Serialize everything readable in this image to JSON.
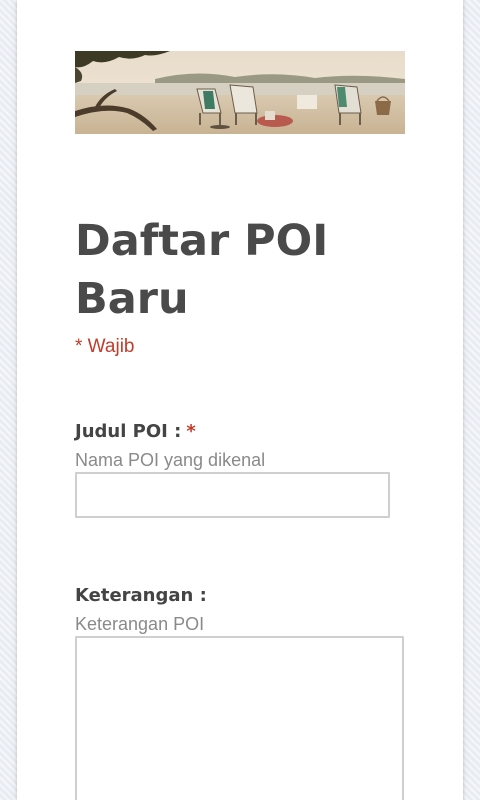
{
  "form": {
    "banner_image": "beach-chairs-banner",
    "title": "Daftar POI Baru",
    "required_note": "* Wajib",
    "questions": [
      {
        "label": "Judul POI :",
        "required_marker": "*",
        "help": "Nama POI yang dikenal",
        "value": "",
        "type": "text"
      },
      {
        "label": "Keterangan :",
        "help": "Keterangan POI",
        "value": "",
        "type": "paragraph"
      }
    ]
  },
  "colors": {
    "page_bg": "#e9edf3",
    "card_bg": "#ffffff",
    "title": "#4a4a4a",
    "required": "#c43b2a",
    "help_text": "#8a8a8a",
    "input_border": "#cfcfcf"
  }
}
